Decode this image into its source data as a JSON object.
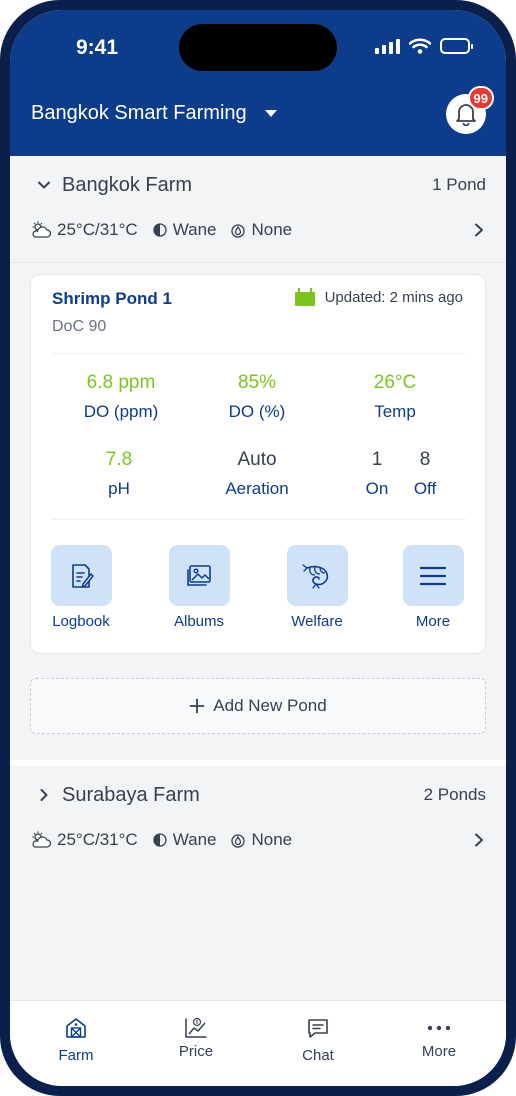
{
  "status_bar": {
    "time": "9:41"
  },
  "header": {
    "farm_selector": "Bangkok Smart Farming",
    "notification_count": "99"
  },
  "farms": [
    {
      "name": "Bangkok Farm",
      "pond_count": "1 Pond",
      "expanded": true,
      "weather": {
        "temp": "25°C/31°C",
        "moon": "Wane",
        "rain": "None"
      },
      "ponds": [
        {
          "name": "Shrimp Pond 1",
          "doc": "DoC 90",
          "updated": "Updated: 2 mins ago",
          "metrics": {
            "do_ppm": {
              "value": "6.8 ppm",
              "label": "DO (ppm)"
            },
            "do_pct": {
              "value": "85%",
              "label": "DO (%)"
            },
            "temp": {
              "value": "26°C",
              "label": "Temp"
            },
            "ph": {
              "value": "7.8",
              "label": "pH"
            },
            "aeration": {
              "value": "Auto",
              "label": "Aeration"
            },
            "on": {
              "value": "1",
              "label": "On"
            },
            "off": {
              "value": "8",
              "label": "Off"
            }
          },
          "actions": [
            "Logbook",
            "Albums",
            "Welfare",
            "More"
          ]
        }
      ],
      "add_pond_label": "Add New Pond"
    },
    {
      "name": "Surabaya Farm",
      "pond_count": "2 Ponds",
      "expanded": false,
      "weather": {
        "temp": "25°C/31°C",
        "moon": "Wane",
        "rain": "None"
      }
    }
  ],
  "bottom_nav": [
    {
      "label": "Farm",
      "icon": "barn-icon",
      "active": true
    },
    {
      "label": "Price",
      "icon": "price-chart-icon"
    },
    {
      "label": "Chat",
      "icon": "chat-icon"
    },
    {
      "label": "More",
      "icon": "more-dots-icon"
    }
  ],
  "colors": {
    "primary": "#0d3c8b",
    "good": "#7cc520",
    "badge": "#e53935",
    "tile": "#cfe2f8"
  }
}
